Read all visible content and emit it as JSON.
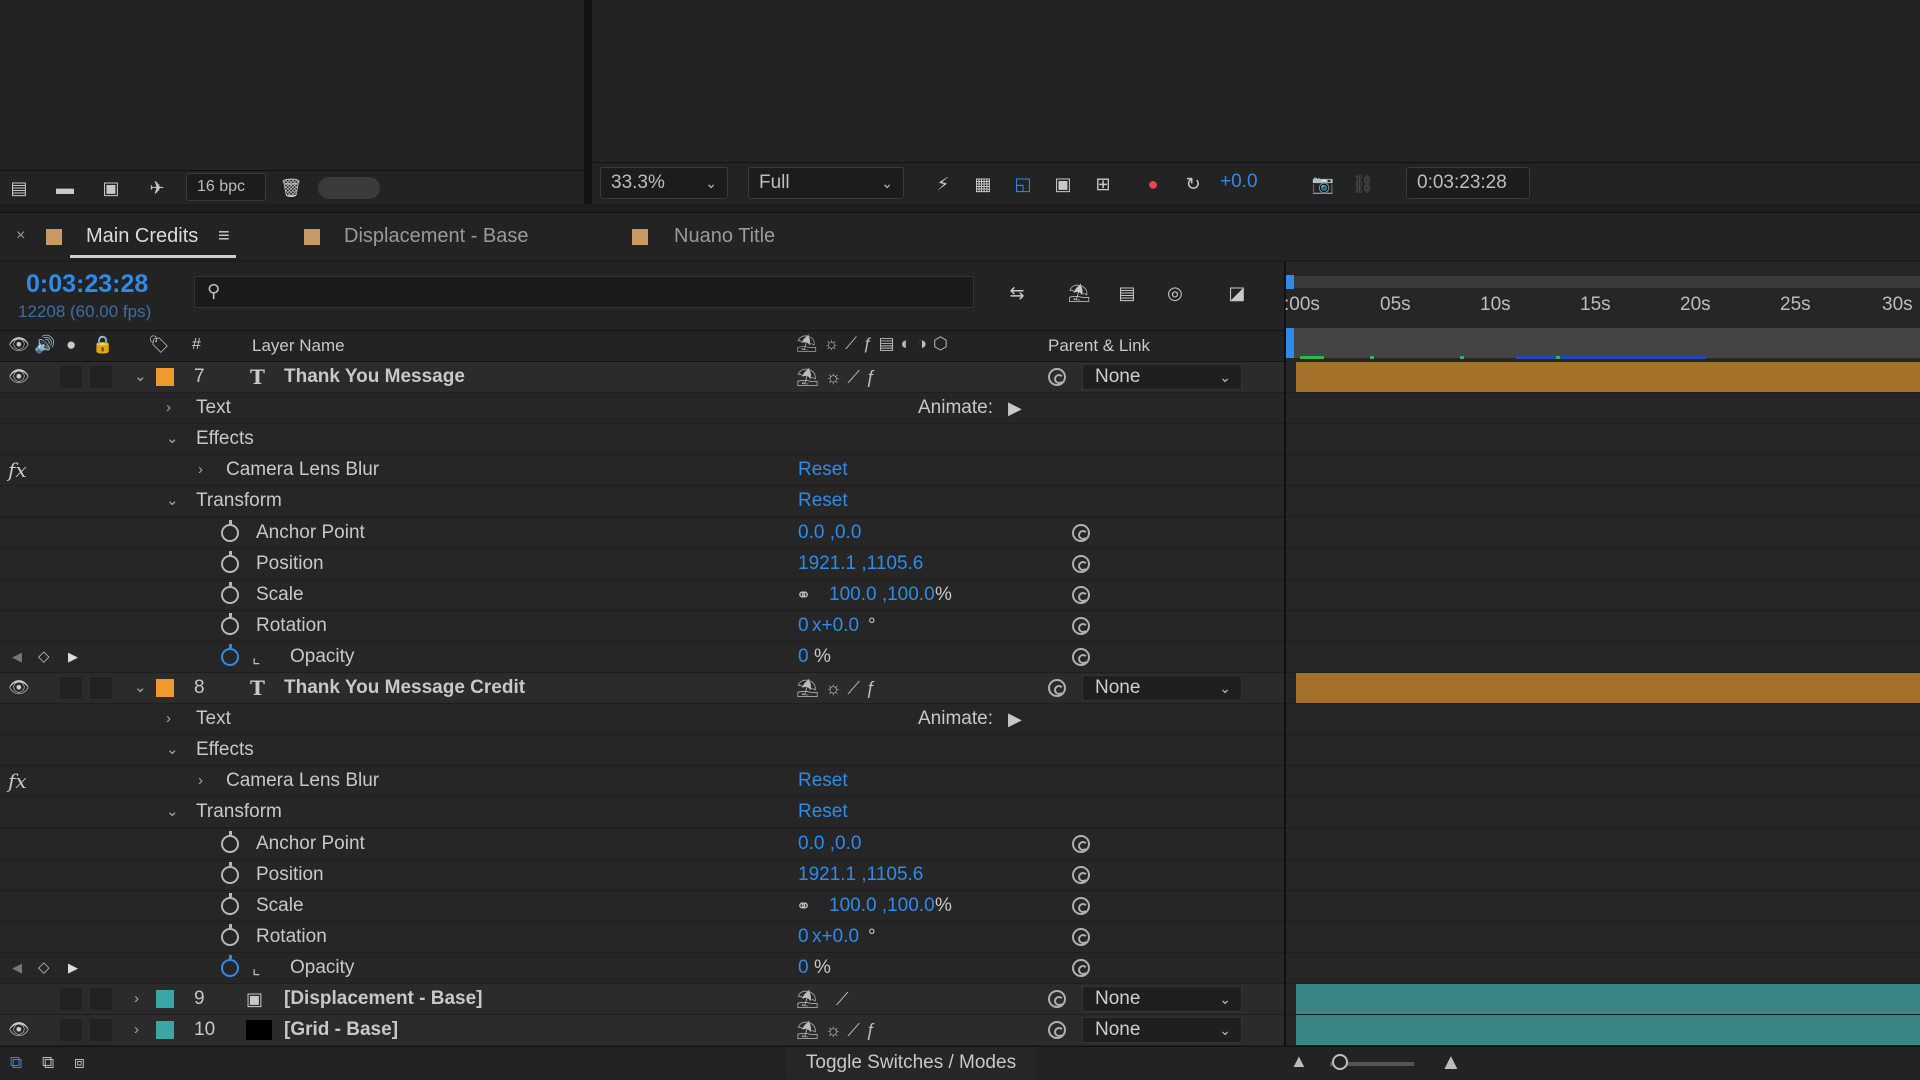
{
  "project": {
    "bpc": "16 bpc"
  },
  "viewer": {
    "zoom": "33.3%",
    "resolution": "Full",
    "exposure": "+0.0",
    "timecode": "0:03:23:28"
  },
  "tabs": [
    {
      "label": "Main Credits",
      "color": "#c79b64",
      "active": true
    },
    {
      "label": "Displacement - Base",
      "color": "#c79b64",
      "active": false
    },
    {
      "label": "Nuano Title",
      "color": "#c79b64",
      "active": false
    }
  ],
  "timeline": {
    "current_time": "0:03:23:28",
    "frame_info": "12208 (60.00 fps)",
    "search_placeholder": "",
    "ruler": [
      ":00s",
      "05s",
      "10s",
      "15s",
      "20s",
      "25s",
      "30s"
    ]
  },
  "columns": {
    "num": "#",
    "layer_name": "Layer Name",
    "parent": "Parent & Link"
  },
  "labels": {
    "animate": "Animate:",
    "reset": "Reset",
    "text": "Text",
    "effects": "Effects",
    "camera_lens_blur": "Camera Lens Blur",
    "transform": "Transform",
    "anchor_point": "Anchor Point",
    "position": "Position",
    "scale": "Scale",
    "rotation": "Rotation",
    "opacity": "Opacity",
    "none": "None",
    "fx": "fx",
    "type_t": "T"
  },
  "layers": [
    {
      "num": "7",
      "name": "Thank You Message",
      "color": "#f09a2c",
      "anchor": "0.0 ,0.0",
      "position": "1921.1 ,1105.6",
      "scale": "100.0 ,100.0",
      "scale_unit": "%",
      "rotation_turns": "0",
      "rotation_deg": "x+0.0",
      "rotation_unit": "°",
      "opacity": "0",
      "opacity_unit": "%"
    },
    {
      "num": "8",
      "name": "Thank You Message Credit",
      "color": "#f09a2c",
      "anchor": "0.0 ,0.0",
      "position": "1921.1 ,1105.6",
      "scale": "100.0 ,100.0",
      "scale_unit": "%",
      "rotation_turns": "0",
      "rotation_deg": "x+0.0",
      "rotation_unit": "°",
      "opacity": "0",
      "opacity_unit": "%"
    },
    {
      "num": "9",
      "name": "[Displacement - Base]",
      "color": "#3aa6a6"
    },
    {
      "num": "10",
      "name": "[Grid - Base]",
      "color": "#3aa6a6"
    }
  ],
  "bottom": {
    "toggle": "Toggle Switches / Modes"
  },
  "colors": {
    "accent": "#2d8ceb",
    "text_layer_bar": "#a4702a",
    "precomp_bar": "#3a8686"
  }
}
